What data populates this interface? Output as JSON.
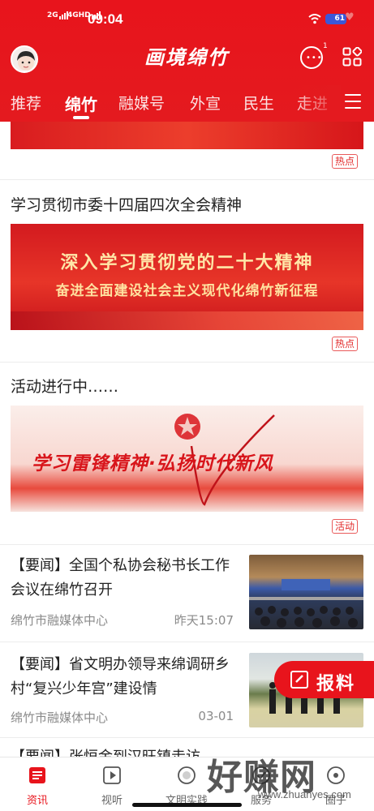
{
  "status_bar": {
    "signal1": "2G",
    "signal2": "4GHD",
    "time": "09:04",
    "battery": "61"
  },
  "header": {
    "logo_text": "画境绵竹",
    "message_count": "1"
  },
  "tabs": [
    {
      "label": "推荐",
      "active": false
    },
    {
      "label": "绵竹",
      "active": true
    },
    {
      "label": "融媒号",
      "active": false
    },
    {
      "label": "外宣",
      "active": false
    },
    {
      "label": "民生",
      "active": false
    },
    {
      "label": "走进",
      "active": false
    }
  ],
  "feed": {
    "top_tag": "热点",
    "card1": {
      "title": "学习贯彻市委十四届四次全会精神",
      "banner_line1": "深入学习贯彻党的二十大精神",
      "banner_line2": "奋进全面建设社会主义现代化绵竹新征程",
      "tag": "热点"
    },
    "card2": {
      "title": "活动进行中……",
      "banner_text": "学习雷锋精神·弘扬时代新风",
      "tag": "活动"
    },
    "news": [
      {
        "title": "【要闻】全国个私协会秘书长工作会议在绵竹召开",
        "source": "绵竹市融媒体中心",
        "time": "昨天15:07"
      },
      {
        "title": "【要闻】省文明办领导来绵调研乡村“复兴少年宫”建设情",
        "source": "绵竹市融媒体中心",
        "time": "03-01"
      },
      {
        "title": "【要闻】张恒金到汉旺镇走访"
      }
    ]
  },
  "report_button": {
    "label": "报料"
  },
  "bottom_nav": [
    {
      "label": "资讯",
      "icon": "news-icon",
      "active": true
    },
    {
      "label": "视听",
      "icon": "play-icon",
      "active": false
    },
    {
      "label": "文明实践",
      "icon": "civilization-icon",
      "active": false
    },
    {
      "label": "服务",
      "icon": "service-icon",
      "active": false
    },
    {
      "label": "圈子",
      "icon": "circle-icon",
      "active": false
    }
  ],
  "watermark": {
    "big": "好赚网",
    "small": "www.zhuanyes.com"
  },
  "colors": {
    "brand_red": "#e8141c",
    "tag_red": "#e22a2a",
    "gold_text": "#ffe7a8"
  }
}
